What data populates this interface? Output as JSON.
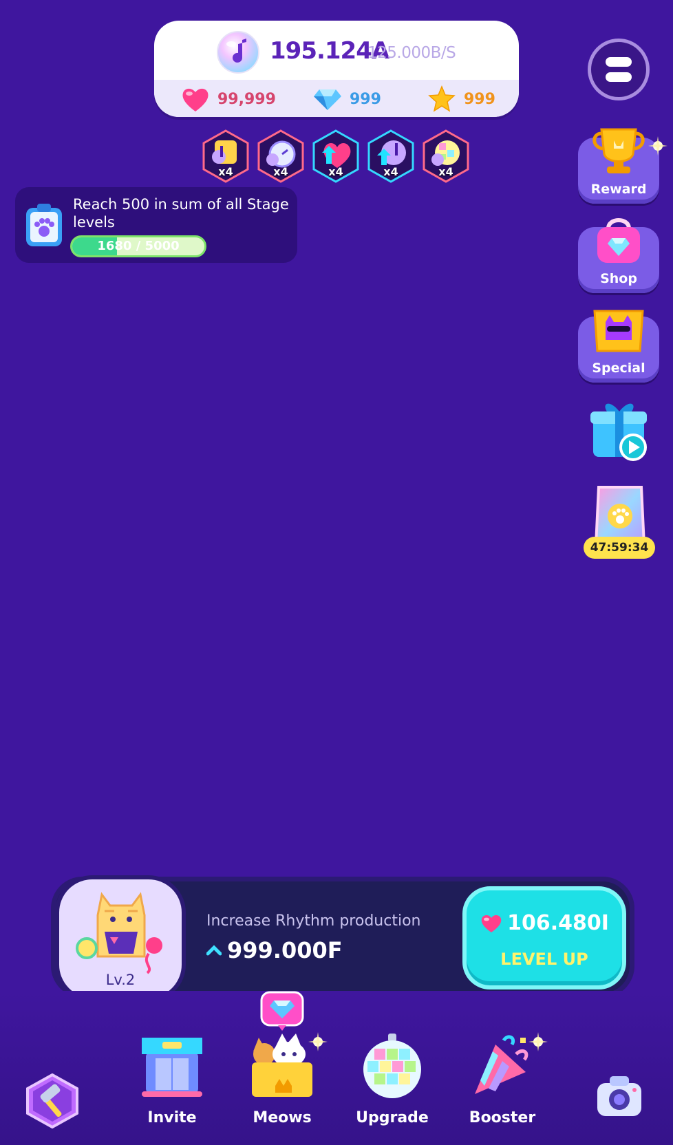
{
  "header": {
    "rhythm_amount": "195.124A",
    "rhythm_rate": "125.000B/S",
    "hearts": "99,999",
    "gems": "999",
    "stars": "999"
  },
  "boosts": [
    {
      "icon": "rhythm-boost-icon",
      "count": "x4"
    },
    {
      "icon": "speed-boost-icon",
      "count": "x4"
    },
    {
      "icon": "heart-boost-icon",
      "count": "x4"
    },
    {
      "icon": "orb-boost-icon",
      "count": "x4"
    },
    {
      "icon": "disco-boost-icon",
      "count": "x4"
    }
  ],
  "mission": {
    "text": "Reach 500 in sum of all Stage levels",
    "progress_label": "1680 / 5000",
    "progress_value": 1680,
    "progress_max": 5000
  },
  "side_buttons": {
    "reward": "Reward",
    "shop": "Shop",
    "special": "Special",
    "pack_timer": "47:59:34"
  },
  "upgrade": {
    "level": "Lv.2",
    "description": "Increase Rhythm production",
    "value": "999.000F",
    "cost": "106.480I",
    "action": "LEVEL UP"
  },
  "nav": {
    "invite": "Invite",
    "meows": "Meows",
    "upgrade": "Upgrade",
    "booster": "Booster"
  },
  "colors": {
    "background": "#3f169e",
    "accent_cyan": "#1ee0e6",
    "heart_pink": "#d6456d",
    "gem_blue": "#3a9be6",
    "star_orange": "#f0931c"
  }
}
